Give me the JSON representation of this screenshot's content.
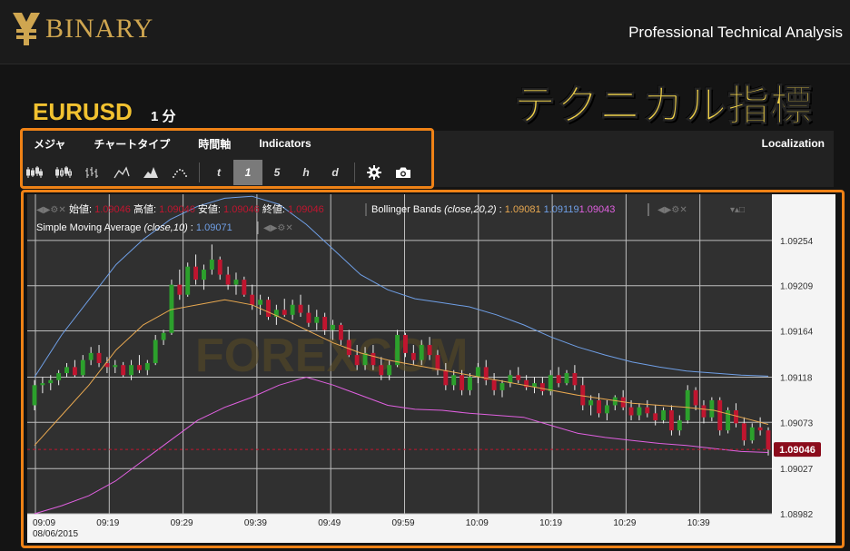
{
  "header": {
    "logo_text": "BINARY",
    "tagline": "Professional Technical Analysis"
  },
  "banner": {
    "title": "テクニカル指標"
  },
  "instrument": {
    "symbol": "EURUSD",
    "period": "1 分"
  },
  "menu": {
    "items": [
      "メジャ",
      "チャートタイプ",
      "時間軸",
      "Indicators"
    ],
    "localization": "Localization"
  },
  "timeframes": [
    "t",
    "1",
    "5",
    "h",
    "d"
  ],
  "active_timeframe": "1",
  "colors": {
    "accent": "#ef8216",
    "symbol": "#f2c230",
    "candle_up": "#2ca02c",
    "candle_down": "#c0152f",
    "sma": "#e8a850",
    "bb_upper": "#6f9fe6",
    "bb_lower": "#e060e0",
    "price_tag": "#8b0c1c"
  },
  "legend": {
    "ohlc_open_label": "始値:",
    "ohlc_open_value": "1.09046",
    "ohlc_high_label": "高値:",
    "ohlc_high_value": "1.09046",
    "ohlc_low_label": "安値:",
    "ohlc_low_value": "1.09046",
    "ohlc_close_label": "終値:",
    "ohlc_close_value": "1.09046",
    "bb_label": "Bollinger Bands",
    "bb_params": "(close,20,2)",
    "bb_middle": "1.09081",
    "bb_upper": "1.09119",
    "bb_lower": "1.09043",
    "sma_label": "Simple Moving Average",
    "sma_params": "(close,10)",
    "sma_value": "1.09071"
  },
  "chart_data": {
    "type": "candlestick",
    "x_tick_labels": [
      "09:09",
      "09:19",
      "09:29",
      "09:39",
      "09:49",
      "09:59",
      "10:09",
      "10:19",
      "10:29",
      "10:39"
    ],
    "date_label": "08/06/2015",
    "y_tick_labels": [
      "1.09254",
      "1.09209",
      "1.09164",
      "1.09118",
      "1.09073",
      "1.09027",
      "1.08982"
    ],
    "ylim": [
      1.08982,
      1.093
    ],
    "current_price": "1.09046",
    "grid": true,
    "candles": [
      [
        1.0909,
        1.09115,
        1.09085,
        1.0911
      ],
      [
        1.0911,
        1.09118,
        1.09102,
        1.09112
      ],
      [
        1.09112,
        1.0912,
        1.09105,
        1.09115
      ],
      [
        1.09115,
        1.09125,
        1.0911,
        1.09122
      ],
      [
        1.09122,
        1.09132,
        1.09118,
        1.09128
      ],
      [
        1.09128,
        1.09135,
        1.09118,
        1.0912
      ],
      [
        1.0912,
        1.0914,
        1.09118,
        1.09135
      ],
      [
        1.09135,
        1.09148,
        1.0913,
        1.09142
      ],
      [
        1.09142,
        1.0915,
        1.09128,
        1.09132
      ],
      [
        1.09132,
        1.09138,
        1.09122,
        1.09128
      ],
      [
        1.09128,
        1.09135,
        1.09122,
        1.0913
      ],
      [
        1.0913,
        1.09133,
        1.09118,
        1.0912
      ],
      [
        1.0912,
        1.09135,
        1.09115,
        1.0913
      ],
      [
        1.0913,
        1.0914,
        1.09122,
        1.09125
      ],
      [
        1.09125,
        1.09135,
        1.0912,
        1.09132
      ],
      [
        1.09132,
        1.0916,
        1.0913,
        1.09155
      ],
      [
        1.09155,
        1.09165,
        1.0915,
        1.09162
      ],
      [
        1.09162,
        1.09215,
        1.0916,
        1.0921
      ],
      [
        1.0921,
        1.09225,
        1.09195,
        1.092
      ],
      [
        1.092,
        1.09232,
        1.09198,
        1.09228
      ],
      [
        1.09228,
        1.0924,
        1.0921,
        1.09215
      ],
      [
        1.09215,
        1.0923,
        1.09205,
        1.09225
      ],
      [
        1.09225,
        1.0925,
        1.0922,
        1.09235
      ],
      [
        1.09235,
        1.09238,
        1.09215,
        1.0922
      ],
      [
        1.0922,
        1.09228,
        1.09205,
        1.0921
      ],
      [
        1.0921,
        1.09222,
        1.092,
        1.09215
      ],
      [
        1.09215,
        1.09218,
        1.09198,
        1.092
      ],
      [
        1.092,
        1.0921,
        1.09185,
        1.0919
      ],
      [
        1.0919,
        1.092,
        1.0918,
        1.09195
      ],
      [
        1.09195,
        1.09198,
        1.09175,
        1.09178
      ],
      [
        1.09178,
        1.0919,
        1.0917,
        1.09185
      ],
      [
        1.09185,
        1.09196,
        1.09178,
        1.0918
      ],
      [
        1.0918,
        1.09195,
        1.09175,
        1.0919
      ],
      [
        1.0919,
        1.092,
        1.09178,
        1.09182
      ],
      [
        1.09182,
        1.0919,
        1.09168,
        1.09172
      ],
      [
        1.09172,
        1.09185,
        1.09165,
        1.09178
      ],
      [
        1.09178,
        1.09182,
        1.0916,
        1.09165
      ],
      [
        1.09165,
        1.09175,
        1.09155,
        1.0917
      ],
      [
        1.0917,
        1.09172,
        1.0915,
        1.09155
      ],
      [
        1.09155,
        1.09165,
        1.09138,
        1.0914
      ],
      [
        1.0914,
        1.0915,
        1.09125,
        1.0913
      ],
      [
        1.0913,
        1.09148,
        1.09125,
        1.09142
      ],
      [
        1.09142,
        1.0915,
        1.09125,
        1.0913
      ],
      [
        1.0913,
        1.09138,
        1.09115,
        1.0912
      ],
      [
        1.0912,
        1.09135,
        1.09115,
        1.0913
      ],
      [
        1.0913,
        1.09165,
        1.09128,
        1.0916
      ],
      [
        1.0916,
        1.09162,
        1.09138,
        1.09142
      ],
      [
        1.09142,
        1.0915,
        1.0913,
        1.09135
      ],
      [
        1.09135,
        1.09155,
        1.0913,
        1.0915
      ],
      [
        1.0915,
        1.09158,
        1.09135,
        1.0914
      ],
      [
        1.0914,
        1.09145,
        1.0912,
        1.09125
      ],
      [
        1.09125,
        1.09132,
        1.09105,
        1.0911
      ],
      [
        1.0911,
        1.09125,
        1.09105,
        1.0912
      ],
      [
        1.0912,
        1.09125,
        1.091,
        1.09105
      ],
      [
        1.09105,
        1.09122,
        1.091,
        1.09118
      ],
      [
        1.09118,
        1.09132,
        1.09112,
        1.09128
      ],
      [
        1.09128,
        1.09135,
        1.0911,
        1.09115
      ],
      [
        1.09115,
        1.09122,
        1.091,
        1.09105
      ],
      [
        1.09105,
        1.09115,
        1.09098,
        1.09112
      ],
      [
        1.09112,
        1.09125,
        1.09108,
        1.0912
      ],
      [
        1.0912,
        1.09128,
        1.09112,
        1.09115
      ],
      [
        1.09115,
        1.0912,
        1.09105,
        1.09108
      ],
      [
        1.09108,
        1.09118,
        1.09102,
        1.09112
      ],
      [
        1.09112,
        1.09118,
        1.091,
        1.09104
      ],
      [
        1.09104,
        1.09125,
        1.091,
        1.0912
      ],
      [
        1.0912,
        1.09128,
        1.09108,
        1.09112
      ],
      [
        1.09112,
        1.09125,
        1.0911,
        1.09122
      ],
      [
        1.09122,
        1.0913,
        1.09105,
        1.0911
      ],
      [
        1.0911,
        1.09118,
        1.09085,
        1.0909
      ],
      [
        1.0909,
        1.091,
        1.0908,
        1.09095
      ],
      [
        1.09095,
        1.09102,
        1.09078,
        1.09082
      ],
      [
        1.09082,
        1.09095,
        1.09075,
        1.0909
      ],
      [
        1.0909,
        1.091,
        1.09085,
        1.09098
      ],
      [
        1.09098,
        1.09105,
        1.09085,
        1.09088
      ],
      [
        1.09088,
        1.09095,
        1.09075,
        1.0908
      ],
      [
        1.0908,
        1.09092,
        1.09075,
        1.09088
      ],
      [
        1.09088,
        1.09095,
        1.09078,
        1.09082
      ],
      [
        1.09082,
        1.0909,
        1.0907,
        1.09075
      ],
      [
        1.09075,
        1.09088,
        1.09072,
        1.09085
      ],
      [
        1.09085,
        1.0909,
        1.0906,
        1.09065
      ],
      [
        1.09065,
        1.0908,
        1.0906,
        1.09075
      ],
      [
        1.09075,
        1.0911,
        1.09072,
        1.09105
      ],
      [
        1.09105,
        1.09108,
        1.09085,
        1.0909
      ],
      [
        1.0909,
        1.09095,
        1.09072,
        1.09078
      ],
      [
        1.09078,
        1.09098,
        1.09074,
        1.09095
      ],
      [
        1.09095,
        1.09098,
        1.0906,
        1.09065
      ],
      [
        1.09065,
        1.09088,
        1.09062,
        1.09085
      ],
      [
        1.09085,
        1.09092,
        1.09068,
        1.09072
      ],
      [
        1.09072,
        1.09078,
        1.0905,
        1.09055
      ],
      [
        1.09055,
        1.09072,
        1.09052,
        1.09068
      ],
      [
        1.09068,
        1.09078,
        1.0906,
        1.09065
      ],
      [
        1.09065,
        1.09068,
        1.0904,
        1.09046
      ]
    ],
    "bb_upper": [
      1.09118,
      1.0916,
      1.09195,
      1.0923,
      1.09255,
      1.09275,
      1.09288,
      1.09296,
      1.09298,
      1.0929,
      1.0927,
      1.09245,
      1.0922,
      1.09205,
      1.09196,
      1.09192,
      1.09188,
      1.0918,
      1.0917,
      1.09158,
      1.09148,
      1.0914,
      1.09133,
      1.09128,
      1.09124,
      1.09122,
      1.0912,
      1.09119
    ],
    "bb_lower": [
      1.08982,
      1.0899,
      1.09,
      1.09015,
      1.09035,
      1.09055,
      1.09075,
      1.09088,
      1.09098,
      1.0911,
      1.09118,
      1.0911,
      1.091,
      1.0909,
      1.09086,
      1.09085,
      1.09082,
      1.0908,
      1.09078,
      1.0907,
      1.09062,
      1.09058,
      1.09055,
      1.09052,
      1.0905,
      1.09047,
      1.09044,
      1.09043
    ],
    "sma": [
      1.0905,
      1.0908,
      1.0911,
      1.09145,
      1.0917,
      1.09185,
      1.0919,
      1.09195,
      1.0919,
      1.09178,
      1.09165,
      1.09152,
      1.09142,
      1.09135,
      1.0913,
      1.09125,
      1.0912,
      1.09115,
      1.0911,
      1.09105,
      1.091,
      1.09096,
      1.09092,
      1.0909,
      1.09088,
      1.09085,
      1.09078,
      1.09071
    ]
  }
}
